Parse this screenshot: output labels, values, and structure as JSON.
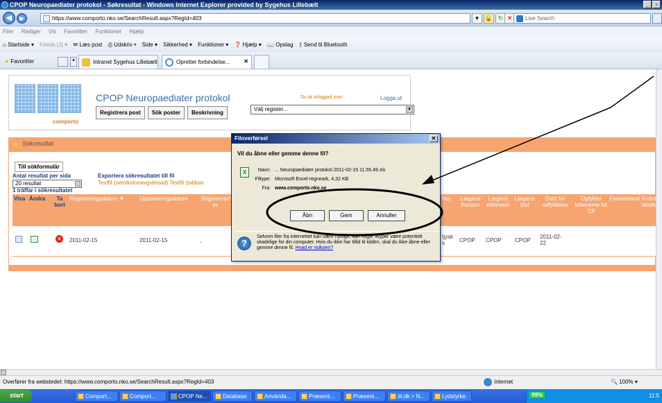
{
  "window": {
    "title": "CPOP Neuropaediater protokol - Søkresultat - Windows Internet Explorer provided by Sygehus Lillebælt"
  },
  "address": {
    "url": "https://www.comporto.nko.se/SearchResult.aspx?RegId=403",
    "search_placeholder": "Live Search"
  },
  "menu": [
    "Filer",
    "Rediger",
    "Vis",
    "Favoritter",
    "Funktioner",
    "Hjælp"
  ],
  "commands": [
    "Startside",
    "Feeds (J)",
    "Læs post",
    "Udskriv",
    "Side",
    "Sikkerhed",
    "Funktioner",
    "Hjælp",
    "Opslag",
    "Send til Bluetooth"
  ],
  "favorites": {
    "label": "Favoritter",
    "tabs": [
      "Intranet Sygehus Lillebælt",
      "Opretter forbindelse..."
    ]
  },
  "app": {
    "logo_text": "comporto",
    "title": "CPOP Neuropaediater protokol",
    "login_status": "Du är inloggad som",
    "logout": "Logga ut",
    "buttons": [
      "Registrera post",
      "Sök poster",
      "Beskrivning"
    ],
    "register_select": "Välj register..."
  },
  "results": {
    "header": "Sökresultat",
    "back_button": "Till sökformulär",
    "per_page_label": "Antal resultat per sida",
    "per_page_value": "20 resultat",
    "export_label": "Exportera sökresultatet till fil",
    "export_links": "Textfil (semikolonavgränsad)  Textfil (tabbav",
    "hits": "1 träffar i sökresultatet",
    "columns": {
      "visa": "Visa",
      "andra": "Ändra",
      "tabort": "Ta bort",
      "regdatum": "Registreringsdatum ▼",
      "upddatum": "Uppdateringsdatum",
      "regav": "Registrerad av",
      "hus": "hus",
      "fornavn": "Lægens fornavn",
      "efternavn": "Lægens efternavn",
      "titel": "Lægens titel",
      "dato": "Dato for udfyldelse",
      "opfylder": "Opfylder kriterierne for CP",
      "fodselsland": "Fødselsland",
      "andre": "Andre lande"
    },
    "row": {
      "regdatum": "2011-02-15",
      "upddatum": "2011-02-15",
      "regav": ",",
      "hus": "tjysk s",
      "fornavn": "CPOP",
      "efternavn": "CPOP",
      "titel": "CPOP",
      "dato": "2011-02-22"
    }
  },
  "dialog": {
    "title": "Filoverførsel",
    "question": "Vil du åbne eller gemme denne fil?",
    "name_label": "Navn:",
    "name_value": "... Neuropaediater protokol 2011-02-15 11.55.49.xls",
    "type_label": "Filtype:",
    "type_value": "Microsoft Excel-regneark, 4,32 KB",
    "from_label": "Fra:",
    "from_value": "www.comporto.nko.se",
    "open": "Åbn",
    "save": "Gem",
    "cancel": "Annuller",
    "warning": "Selvom filer fra internettet kan være nyttige, kan nogle filtyper være potentielt skadelige for din computer. Hvis du ikke har tillid til kilden, skal du ikke åbne eller gemme denne fil.",
    "risk_link": "Hvad er risikoen?"
  },
  "status": {
    "text": "Overfører fra webstedet: https://www.comporto.nko.se/SearchResult.aspx?RegId=403",
    "zone": "Internet",
    "zoom": "100%"
  },
  "taskbar": {
    "start": "start",
    "items": [
      "Comport...",
      "Comport...",
      "CPOP Ne...",
      "Database",
      "Använda...",
      "Præsent...",
      "Præsent...",
      "dr.dk > N...",
      "Lydstyrke"
    ],
    "battery": "99%",
    "clock": "11:5"
  }
}
